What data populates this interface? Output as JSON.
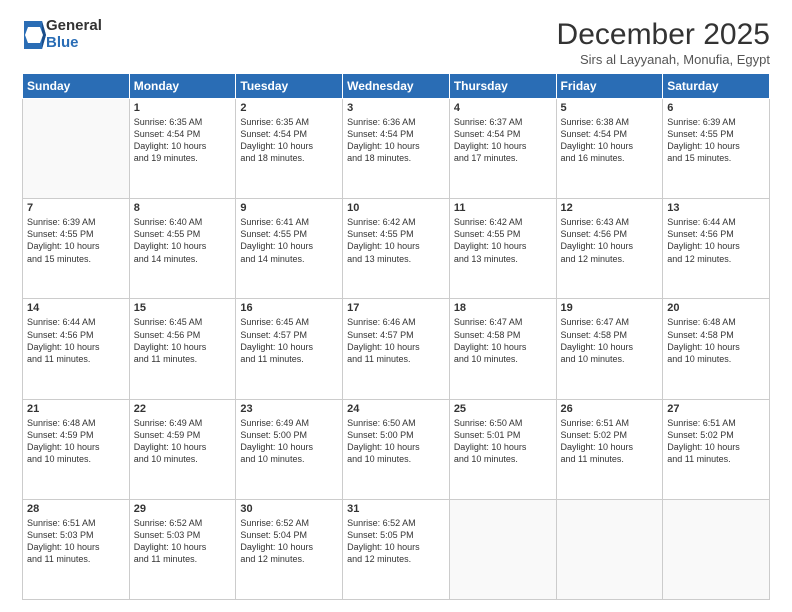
{
  "logo": {
    "general": "General",
    "blue": "Blue"
  },
  "header": {
    "title": "December 2025",
    "subtitle": "Sirs al Layyanah, Monufia, Egypt"
  },
  "weekdays": [
    "Sunday",
    "Monday",
    "Tuesday",
    "Wednesday",
    "Thursday",
    "Friday",
    "Saturday"
  ],
  "weeks": [
    [
      {
        "day": "",
        "info": ""
      },
      {
        "day": "1",
        "info": "Sunrise: 6:35 AM\nSunset: 4:54 PM\nDaylight: 10 hours\nand 19 minutes."
      },
      {
        "day": "2",
        "info": "Sunrise: 6:35 AM\nSunset: 4:54 PM\nDaylight: 10 hours\nand 18 minutes."
      },
      {
        "day": "3",
        "info": "Sunrise: 6:36 AM\nSunset: 4:54 PM\nDaylight: 10 hours\nand 18 minutes."
      },
      {
        "day": "4",
        "info": "Sunrise: 6:37 AM\nSunset: 4:54 PM\nDaylight: 10 hours\nand 17 minutes."
      },
      {
        "day": "5",
        "info": "Sunrise: 6:38 AM\nSunset: 4:54 PM\nDaylight: 10 hours\nand 16 minutes."
      },
      {
        "day": "6",
        "info": "Sunrise: 6:39 AM\nSunset: 4:55 PM\nDaylight: 10 hours\nand 15 minutes."
      }
    ],
    [
      {
        "day": "7",
        "info": "Sunrise: 6:39 AM\nSunset: 4:55 PM\nDaylight: 10 hours\nand 15 minutes."
      },
      {
        "day": "8",
        "info": "Sunrise: 6:40 AM\nSunset: 4:55 PM\nDaylight: 10 hours\nand 14 minutes."
      },
      {
        "day": "9",
        "info": "Sunrise: 6:41 AM\nSunset: 4:55 PM\nDaylight: 10 hours\nand 14 minutes."
      },
      {
        "day": "10",
        "info": "Sunrise: 6:42 AM\nSunset: 4:55 PM\nDaylight: 10 hours\nand 13 minutes."
      },
      {
        "day": "11",
        "info": "Sunrise: 6:42 AM\nSunset: 4:55 PM\nDaylight: 10 hours\nand 13 minutes."
      },
      {
        "day": "12",
        "info": "Sunrise: 6:43 AM\nSunset: 4:56 PM\nDaylight: 10 hours\nand 12 minutes."
      },
      {
        "day": "13",
        "info": "Sunrise: 6:44 AM\nSunset: 4:56 PM\nDaylight: 10 hours\nand 12 minutes."
      }
    ],
    [
      {
        "day": "14",
        "info": "Sunrise: 6:44 AM\nSunset: 4:56 PM\nDaylight: 10 hours\nand 11 minutes."
      },
      {
        "day": "15",
        "info": "Sunrise: 6:45 AM\nSunset: 4:56 PM\nDaylight: 10 hours\nand 11 minutes."
      },
      {
        "day": "16",
        "info": "Sunrise: 6:45 AM\nSunset: 4:57 PM\nDaylight: 10 hours\nand 11 minutes."
      },
      {
        "day": "17",
        "info": "Sunrise: 6:46 AM\nSunset: 4:57 PM\nDaylight: 10 hours\nand 11 minutes."
      },
      {
        "day": "18",
        "info": "Sunrise: 6:47 AM\nSunset: 4:58 PM\nDaylight: 10 hours\nand 10 minutes."
      },
      {
        "day": "19",
        "info": "Sunrise: 6:47 AM\nSunset: 4:58 PM\nDaylight: 10 hours\nand 10 minutes."
      },
      {
        "day": "20",
        "info": "Sunrise: 6:48 AM\nSunset: 4:58 PM\nDaylight: 10 hours\nand 10 minutes."
      }
    ],
    [
      {
        "day": "21",
        "info": "Sunrise: 6:48 AM\nSunset: 4:59 PM\nDaylight: 10 hours\nand 10 minutes."
      },
      {
        "day": "22",
        "info": "Sunrise: 6:49 AM\nSunset: 4:59 PM\nDaylight: 10 hours\nand 10 minutes."
      },
      {
        "day": "23",
        "info": "Sunrise: 6:49 AM\nSunset: 5:00 PM\nDaylight: 10 hours\nand 10 minutes."
      },
      {
        "day": "24",
        "info": "Sunrise: 6:50 AM\nSunset: 5:00 PM\nDaylight: 10 hours\nand 10 minutes."
      },
      {
        "day": "25",
        "info": "Sunrise: 6:50 AM\nSunset: 5:01 PM\nDaylight: 10 hours\nand 10 minutes."
      },
      {
        "day": "26",
        "info": "Sunrise: 6:51 AM\nSunset: 5:02 PM\nDaylight: 10 hours\nand 11 minutes."
      },
      {
        "day": "27",
        "info": "Sunrise: 6:51 AM\nSunset: 5:02 PM\nDaylight: 10 hours\nand 11 minutes."
      }
    ],
    [
      {
        "day": "28",
        "info": "Sunrise: 6:51 AM\nSunset: 5:03 PM\nDaylight: 10 hours\nand 11 minutes."
      },
      {
        "day": "29",
        "info": "Sunrise: 6:52 AM\nSunset: 5:03 PM\nDaylight: 10 hours\nand 11 minutes."
      },
      {
        "day": "30",
        "info": "Sunrise: 6:52 AM\nSunset: 5:04 PM\nDaylight: 10 hours\nand 12 minutes."
      },
      {
        "day": "31",
        "info": "Sunrise: 6:52 AM\nSunset: 5:05 PM\nDaylight: 10 hours\nand 12 minutes."
      },
      {
        "day": "",
        "info": ""
      },
      {
        "day": "",
        "info": ""
      },
      {
        "day": "",
        "info": ""
      }
    ]
  ]
}
